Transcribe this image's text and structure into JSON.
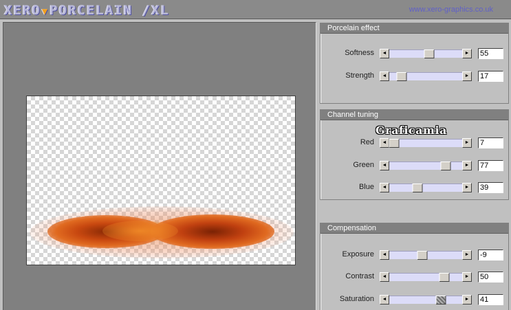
{
  "title": {
    "logo_text": "XERO",
    "logo_text2": "PORCELAIN /XL",
    "website": "www.xero-graphics.co.uk"
  },
  "panels": [
    {
      "title": "Porcelain effect",
      "sliders": [
        {
          "label": "Softness",
          "value": "55",
          "level": 0.55
        },
        {
          "label": "Strength",
          "value": "17",
          "level": 0.17
        }
      ]
    },
    {
      "title": "Channel tuning",
      "watermark": "Graficamia",
      "sliders": [
        {
          "label": "Red",
          "value": "7",
          "level": 0.07
        },
        {
          "label": "Green",
          "value": "77",
          "level": 0.77
        },
        {
          "label": "Blue",
          "value": "39",
          "level": 0.39
        }
      ]
    },
    {
      "title": "Compensation",
      "sliders": [
        {
          "label": "Exposure",
          "value": "-9",
          "level": 0.455
        },
        {
          "label": "Contrast",
          "value": "50",
          "level": 0.75
        },
        {
          "label": "Saturation",
          "value": "41",
          "level": 0.705
        }
      ]
    }
  ],
  "icons": {
    "arrow_left": "◄",
    "arrow_right": "►"
  }
}
